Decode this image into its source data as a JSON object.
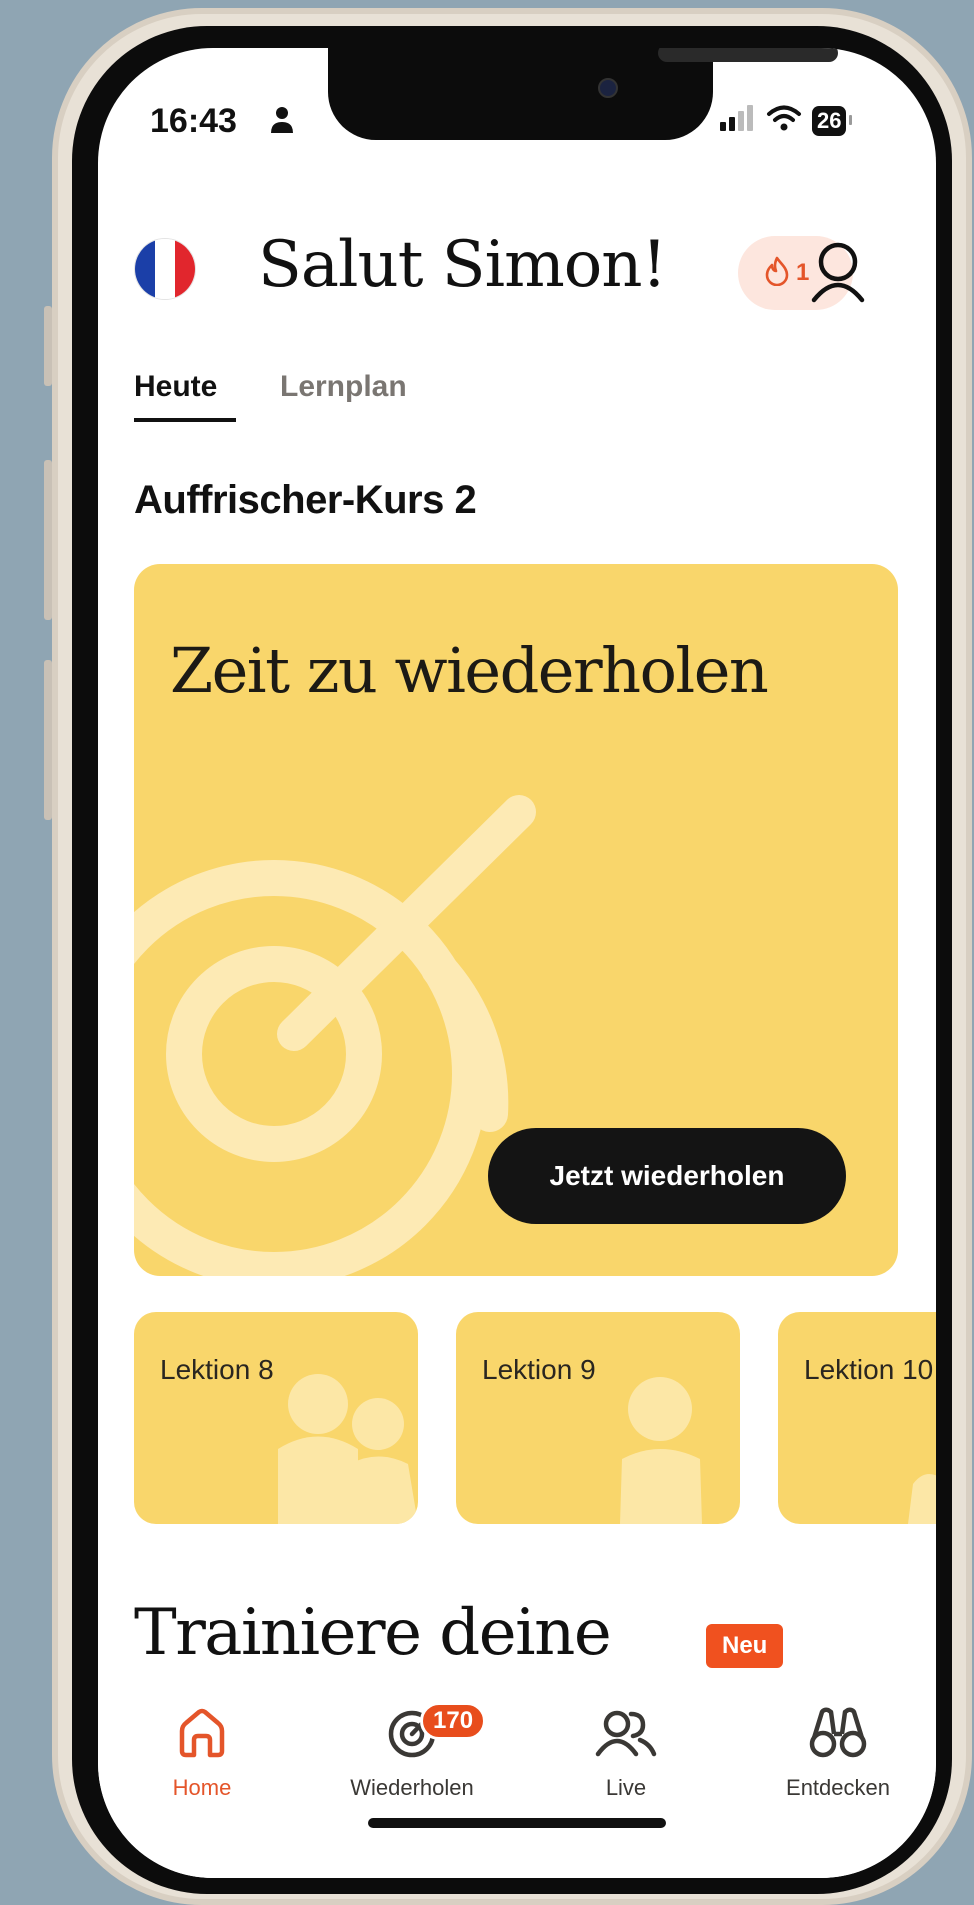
{
  "status_bar": {
    "time": "16:43",
    "battery": "26"
  },
  "header": {
    "greeting": "Salut Simon!",
    "streak_count": "1"
  },
  "tabs": [
    {
      "label": "Heute"
    },
    {
      "label": "Lernplan"
    }
  ],
  "section_title": "Auffrischer-Kurs 2",
  "hero": {
    "title": "Zeit zu wiederholen",
    "button": "Jetzt wiederholen"
  },
  "lessons": [
    {
      "label": "Lektion 8"
    },
    {
      "label": "Lektion 9"
    },
    {
      "label": "Lektion 10"
    }
  ],
  "train": {
    "title": "Trainiere deine",
    "badge": "Neu"
  },
  "nav": {
    "items": [
      {
        "label": "Home",
        "icon": "home-icon"
      },
      {
        "label": "Wiederholen",
        "icon": "target-icon",
        "badge": "170"
      },
      {
        "label": "Live",
        "icon": "people-icon"
      },
      {
        "label": "Entdecken",
        "icon": "binoculars-icon"
      }
    ]
  },
  "colors": {
    "accent": "#e4552a",
    "card": "#f9d66b",
    "button": "#141414"
  }
}
